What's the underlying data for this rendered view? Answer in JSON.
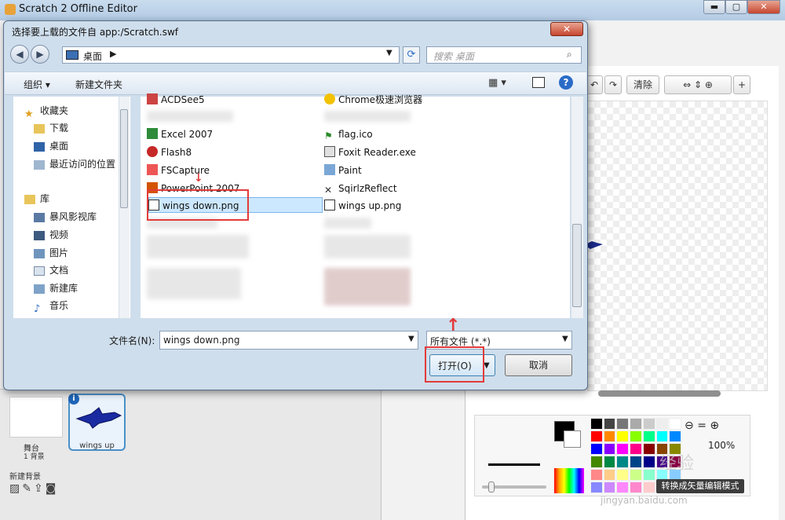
{
  "window": {
    "title": "Scratch 2 Offline Editor",
    "min": "▬",
    "max": "▢",
    "close": "✕"
  },
  "paint_toolbar": {
    "clear": "清除",
    "add": "+"
  },
  "paint": {
    "zoom": "100%",
    "convert_button": "转换成矢量编辑模式",
    "watermark": "经验",
    "watermark_site": "jingyan.baidu.com"
  },
  "stage_panel": {
    "stage_label": "舞台",
    "backdrop_count": "1 背景",
    "new_backdrop": "新建背景",
    "sprite_name": "wings up",
    "sprite_info": "i"
  },
  "dialog": {
    "title": "选择要上载的文件自 app:/Scratch.swf",
    "close": "✕",
    "nav": {
      "back": "◀",
      "forward": "▶",
      "address": "桌面",
      "chevron": "▶",
      "refresh": "⟳",
      "search_placeholder": "搜索 桌面"
    },
    "commands": {
      "organize": "组织 ▾",
      "new_folder": "新建文件夹",
      "help": "?"
    },
    "nav_items": [
      {
        "label": "收藏夹",
        "icon": "star-icon"
      },
      {
        "label": "下载",
        "icon": "download-folder-icon"
      },
      {
        "label": "桌面",
        "icon": "desktop-icon"
      },
      {
        "label": "最近访问的位置",
        "icon": "recent-places-icon"
      },
      {
        "label": "库",
        "icon": "library-icon"
      },
      {
        "label": "暴风影视库",
        "icon": "video-library-icon"
      },
      {
        "label": "视频",
        "icon": "video-icon"
      },
      {
        "label": "图片",
        "icon": "picture-icon"
      },
      {
        "label": "文档",
        "icon": "document-icon"
      },
      {
        "label": "新建库",
        "icon": "new-library-icon"
      },
      {
        "label": "音乐",
        "icon": "music-icon"
      }
    ],
    "files_left": [
      "ACDSee5",
      "Excel 2007",
      "Flash8",
      "FSCapture",
      "PowerPoint 2007",
      "wings down.png"
    ],
    "files_right": [
      "Chrome极速浏览器",
      "flag.ico",
      "Foxit Reader.exe",
      "Paint",
      "SqirlzReflect",
      "wings up.png"
    ],
    "filename_label": "文件名(N):",
    "filename_value": "wings down.png",
    "filter_value": "所有文件 (*.*)",
    "open_button": "打开(O)",
    "cancel_button": "取消"
  }
}
